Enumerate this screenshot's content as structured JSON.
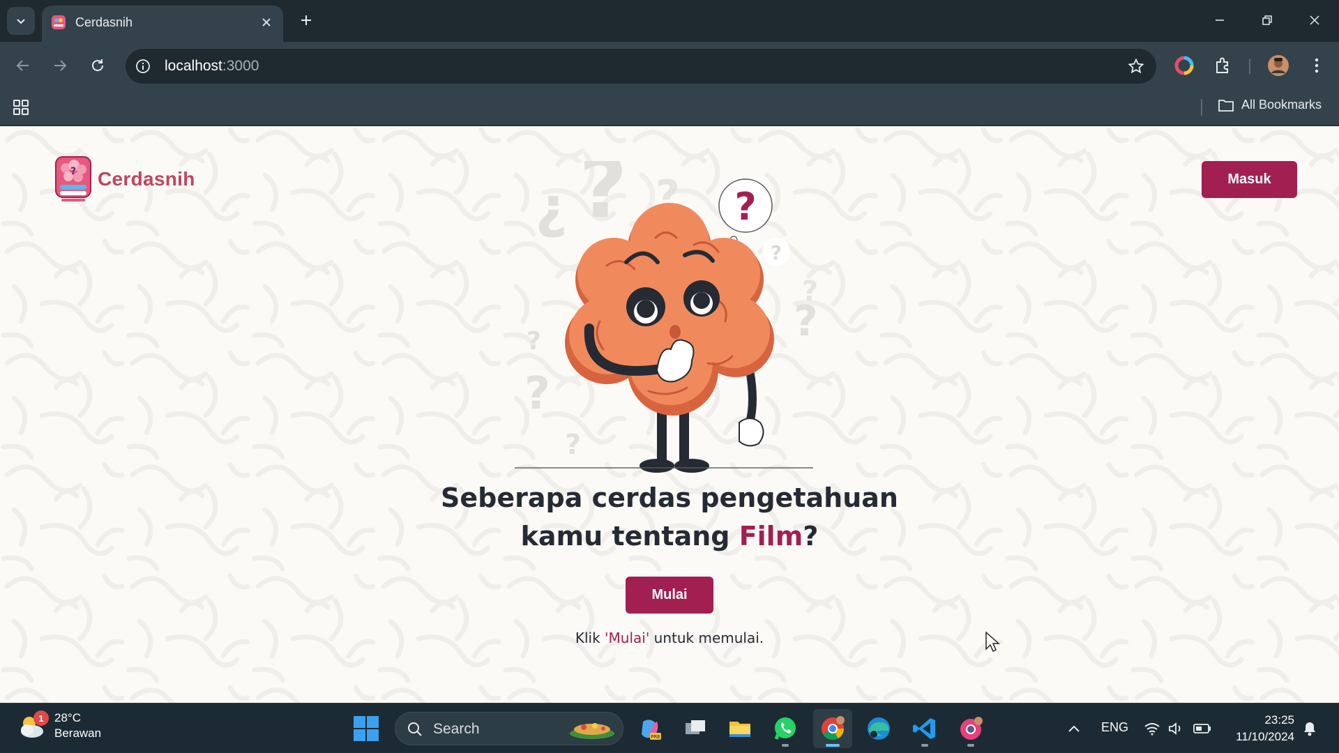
{
  "browser": {
    "tab_title": "Cerdasnih",
    "url_host": "localhost",
    "url_port": ":3000",
    "bookmarks_label": "All Bookmarks"
  },
  "page": {
    "brand_name": "Cerdasnih",
    "login_label": "Masuk",
    "headline_prefix": "Seberapa cerdas pengetahuan",
    "headline_line2_prefix": "kamu tentang ",
    "headline_topic": "Film",
    "headline_suffix": "?",
    "start_label": "Mulai",
    "hint_prefix": "Klik ",
    "hint_highlight": "'Mulai'",
    "hint_suffix": " untuk memulai.",
    "colors": {
      "accent": "#a21f52",
      "brand": "#c0455e",
      "text": "#262a33",
      "background": "#fbfaf7",
      "brain": "#f08a5d"
    }
  },
  "taskbar": {
    "weather_temp": "28°C",
    "weather_desc": "Berawan",
    "weather_badge": "1",
    "search_label": "Search",
    "language": "ENG",
    "time": "23:25",
    "date": "11/10/2024",
    "apps": [
      "windows-start-icon",
      "copilot-icon",
      "task-view-icon",
      "file-explorer-icon",
      "whatsapp-icon",
      "chrome-icon",
      "edge-icon",
      "vscode-icon",
      "chrome-profile-icon"
    ]
  }
}
